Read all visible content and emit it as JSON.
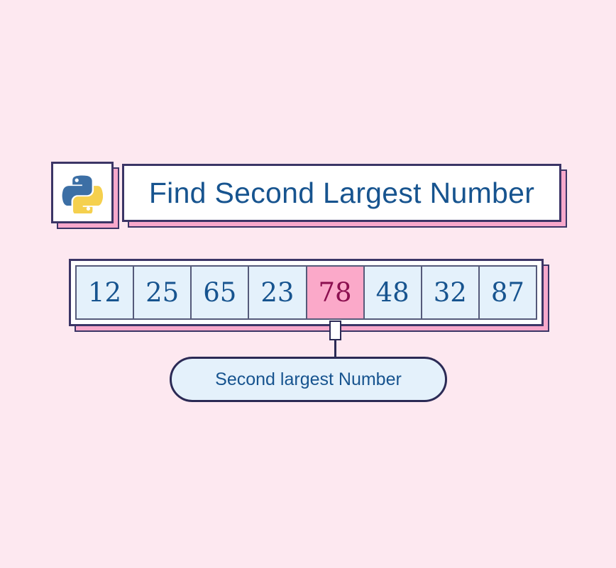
{
  "background_color": "#fde8f0",
  "header": {
    "logo": {
      "icon": "python-logo-icon",
      "alt": "Python",
      "blue": "#3c6fa5",
      "yellow": "#f5d04e"
    },
    "title": "Find Second Largest Number",
    "title_color": "#17548f"
  },
  "array": {
    "cells": [
      {
        "value": "12",
        "highlighted": false
      },
      {
        "value": "25",
        "highlighted": false
      },
      {
        "value": "65",
        "highlighted": false
      },
      {
        "value": "23",
        "highlighted": false
      },
      {
        "value": "78",
        "highlighted": true
      },
      {
        "value": "48",
        "highlighted": false
      },
      {
        "value": "32",
        "highlighted": false
      },
      {
        "value": "87",
        "highlighted": false
      }
    ],
    "cell_fill": "#e4f1fb",
    "cell_text_color": "#17548f",
    "highlight_fill": "#fba9c9",
    "highlight_text_color": "#8c1050"
  },
  "callout": {
    "label": "Second largest Number",
    "fill": "#e4f1fb",
    "border_color": "#2b2a55",
    "text_color": "#17548f"
  },
  "decor": {
    "shadow_color": "#f7a8cb",
    "border_color": "#3b3566"
  }
}
